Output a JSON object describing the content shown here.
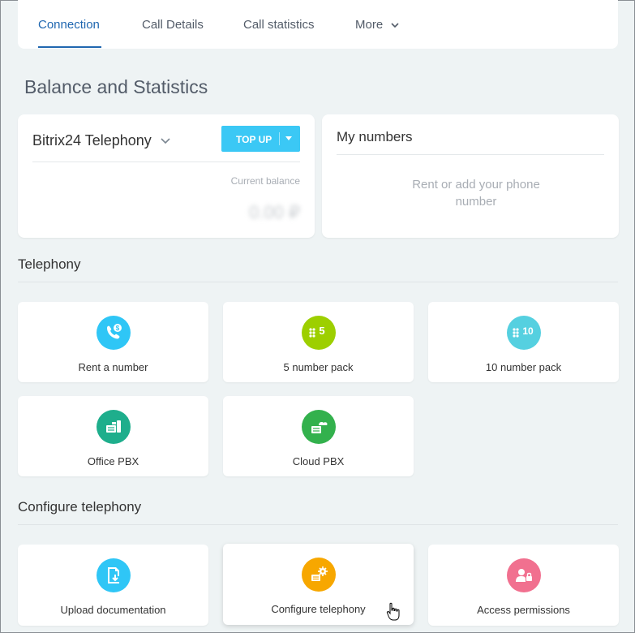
{
  "tabs": [
    {
      "label": "Connection",
      "active": true
    },
    {
      "label": "Call Details"
    },
    {
      "label": "Call statistics"
    },
    {
      "label": "More"
    }
  ],
  "balance_section": {
    "title": "Balance and Statistics",
    "provider": "Bitrix24 Telephony",
    "topup_label": "TOP UP",
    "current_balance_label": "Current balance",
    "current_balance_value": "0.00 ₽"
  },
  "my_numbers": {
    "title": "My numbers",
    "empty_text": "Rent or add your phone number"
  },
  "telephony": {
    "title": "Telephony",
    "tiles": [
      {
        "label": "Rent a number",
        "icon": "phone-dollar-icon",
        "color": "#2fc6f6"
      },
      {
        "label": "5 number pack",
        "icon": "five-numbers-icon",
        "color": "#9dcf00",
        "badge": "5"
      },
      {
        "label": "10 number pack",
        "icon": "ten-numbers-icon",
        "color": "#55d0e0",
        "badge": "10"
      },
      {
        "label": "Office PBX",
        "icon": "office-pbx-icon",
        "color": "#1eae8c"
      },
      {
        "label": "Cloud PBX",
        "icon": "cloud-pbx-icon",
        "color": "#33b14d"
      }
    ]
  },
  "configure": {
    "title": "Configure telephony",
    "tiles": [
      {
        "label": "Upload documentation",
        "icon": "upload-document-icon",
        "color": "#2fc6f6"
      },
      {
        "label": "Configure telephony",
        "icon": "configure-settings-icon",
        "color": "#f7a700"
      },
      {
        "label": "Access permissions",
        "icon": "access-lock-icon",
        "color": "#f1708f"
      }
    ]
  }
}
